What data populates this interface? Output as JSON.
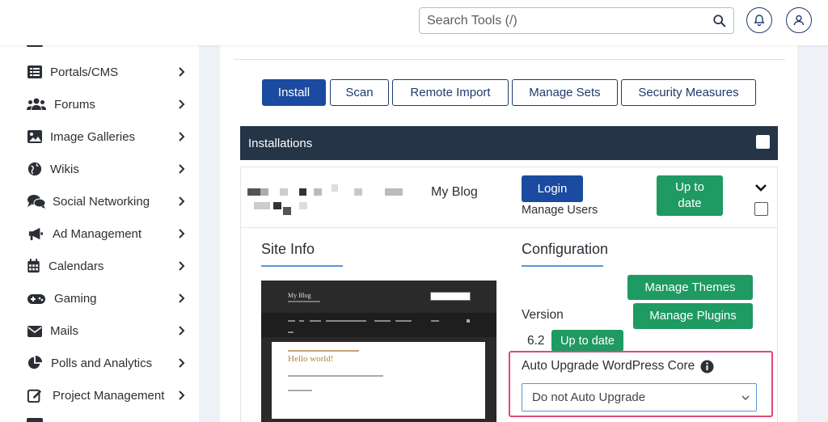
{
  "header": {
    "search_placeholder": "Search Tools (/)"
  },
  "sidebar": {
    "items": [
      {
        "label": "Portals/CMS",
        "icon": "list-icon"
      },
      {
        "label": "Forums",
        "icon": "users-icon"
      },
      {
        "label": "Image Galleries",
        "icon": "image-icon"
      },
      {
        "label": "Wikis",
        "icon": "globe-icon"
      },
      {
        "label": "Social Networking",
        "icon": "comments-icon"
      },
      {
        "label": "Ad Management",
        "icon": "megaphone-icon"
      },
      {
        "label": "Calendars",
        "icon": "calendar-icon"
      },
      {
        "label": "Gaming",
        "icon": "gamepad-icon"
      },
      {
        "label": "Mails",
        "icon": "envelope-icon"
      },
      {
        "label": "Polls and Analytics",
        "icon": "pie-chart-icon"
      },
      {
        "label": "Project Management",
        "icon": "edit-icon"
      }
    ]
  },
  "tabs": {
    "install": "Install",
    "scan": "Scan",
    "remote_import": "Remote Import",
    "manage_sets": "Manage Sets",
    "security_measures": "Security Measures"
  },
  "installations": {
    "header": "Installations",
    "row": {
      "site_name": "My Blog",
      "login": "Login",
      "manage_users": "Manage Users",
      "status": "Up to date"
    }
  },
  "site_info": {
    "title": "Site Info",
    "preview": {
      "blog_title": "My Blog",
      "post_title": "Hello world!"
    }
  },
  "configuration": {
    "title": "Configuration",
    "manage_themes": "Manage Themes",
    "manage_plugins": "Manage Plugins",
    "version_label": "Version",
    "version_value": "6.2",
    "version_status": "Up to date",
    "auto_upgrade_label": "Auto Upgrade WordPress Core",
    "auto_upgrade_value": "Do not Auto Upgrade"
  },
  "colors": {
    "primary_blue": "#1b4ba0",
    "success_green": "#1e9a62",
    "header_dark": "#253447",
    "highlight_pink": "#e0497d"
  }
}
